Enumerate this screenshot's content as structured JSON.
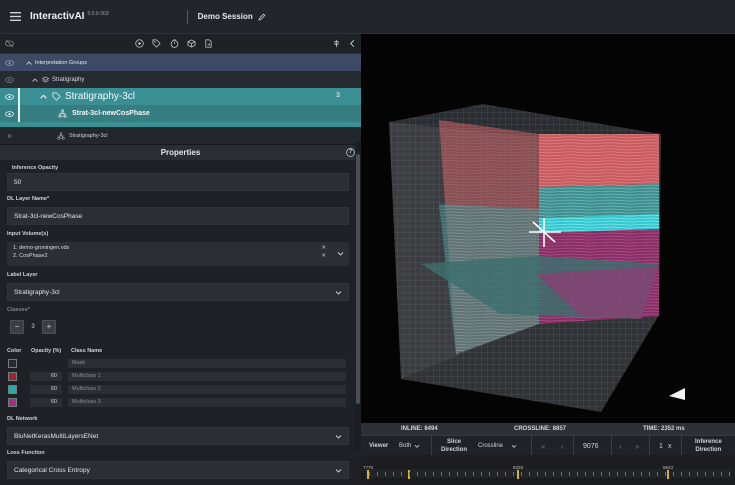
{
  "app": {
    "name": "InteractivAI",
    "version": "5.0.0-303",
    "session": "Demo Session"
  },
  "tree": {
    "groups_label": "Interpretation Groups",
    "stratigraphy_label": "Stratigraphy",
    "strat3_label": "Stratigraphy-3cl",
    "strat3_count": "3",
    "cos_label": "Strat-3cl-newCosPhase",
    "strat1_label": "Stratigraphy-3cl"
  },
  "properties": {
    "title": "Properties",
    "opacity_label": "Inference Opacity",
    "opacity_value": "50",
    "dl_layer_label": "DL Layer Name*",
    "dl_layer_value": "Strat-3cl-newCosPhase",
    "input_label": "Input Volume(s)",
    "volumes": [
      "1. demo-groningen.vds",
      "2. CosPhase2"
    ],
    "label_layer_label": "Label Layer",
    "label_layer_value": "Stratigraphy-3cl",
    "classes_label": "Classes*",
    "classes_value": "3",
    "col_color": "Color",
    "col_opacity": "Opacity (%)",
    "col_name": "Class Name",
    "classes": [
      {
        "color": "#26292e",
        "opacity": "",
        "name": "Mask"
      },
      {
        "color": "#a12233",
        "opacity": "60",
        "name": "Multiclass 1"
      },
      {
        "color": "#2aa9a9",
        "opacity": "60",
        "name": "Multiclass 2"
      },
      {
        "color": "#a2307e",
        "opacity": "60",
        "name": "Multiclass 3"
      }
    ],
    "network_label": "DL Network",
    "network_value": "BluNetKerasMultiLayersENet",
    "loss_label": "Loss Function",
    "loss_value": "Categorical Cross Entropy"
  },
  "status": {
    "inline": "INLINE: 8494",
    "crossline": "CROSSLINE: 8857",
    "time": "TIME: 2352 ms"
  },
  "controls": {
    "viewer_label": "Viewer",
    "viewer_value": "Both",
    "slice_label_1": "Slice",
    "slice_label_2": "Direction",
    "slice_value": "Crossline",
    "slice_index": "9076",
    "step": "1",
    "step_unit": "x",
    "inference_1": "Inference",
    "inference_2": "Direction"
  },
  "timeline": {
    "left_label": "7775",
    "mid_label": "8329",
    "right_label": "8643"
  },
  "colors": {
    "accent_teal": "#3a8f93",
    "groups_blue": "#3d4a64",
    "marker": "#d7b13a"
  }
}
